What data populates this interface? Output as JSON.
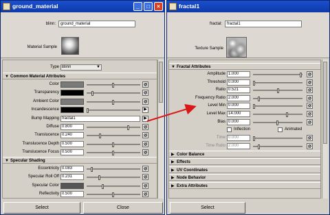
{
  "win1": {
    "title": "ground_material",
    "type_label": "blinn:",
    "name_value": "ground_material",
    "sample_label": "Material Sample",
    "type_row_label": "Type",
    "type_value": "Blinn",
    "sec_common": "Common Material Attributes",
    "color_label": "Color",
    "transparency_label": "Transparency",
    "ambient_label": "Ambient Color",
    "incandescence_label": "Incandescence",
    "bump_label": "Bump Mapping",
    "bump_value": "fractal1",
    "diffuse_label": "Diffuse",
    "diffuse_value": "0.800",
    "translucence_label": "Translucence",
    "translucence_value": "0.240",
    "tdepth_label": "Translucence Depth",
    "tdepth_value": "0.500",
    "tfocus_label": "Translucence Focus",
    "tfocus_value": "0.500",
    "sec_spec": "Specular Shading",
    "ecc_label": "Eccentricity",
    "ecc_value": "0.083",
    "sro_label": "Specular Roll Off",
    "sro_value": "0.231",
    "spec_color_label": "Specular Color",
    "refl_label": "Reflectivity",
    "refl_value": "0.500",
    "refl_color_label": "Reflected Color",
    "select": "Select",
    "close": "Close",
    "colors": {
      "color": "#7a7a7a",
      "transparency": "#000000",
      "ambient": "#7a7a7a",
      "incandescence": "#000000",
      "spec": "#555555",
      "refl_color": "#000000"
    },
    "levels": {
      "diffuse": 0.8,
      "translucence": 0.24,
      "tdepth": 0.5,
      "tfocus": 0.5,
      "ecc": 0.083,
      "sro": 0.231,
      "refl": 0.5,
      "color": 0.5,
      "transparency": 0.1,
      "ambient": 0.5,
      "incandescence": 0.0,
      "spec": 0.3
    }
  },
  "win2": {
    "title": "fractal1",
    "type_label": "fractal:",
    "name_value": "fractal1",
    "sample_label": "Texture Sample",
    "sec_fractal": "Fractal Attributes",
    "amp_label": "Amplitude",
    "amp_value": "1.000",
    "thr_label": "Threshold",
    "thr_value": "0.000",
    "ratio_label": "Ratio",
    "ratio_value": "0.521",
    "freq_label": "Frequency Ratio",
    "freq_value": "2.000",
    "lmin_label": "Level Min",
    "lmin_value": "0.000",
    "lmax_label": "Level Max",
    "lmax_value": "14.000",
    "bias_label": "Bias",
    "bias_value": "0.000",
    "inflection_label": "Inflection",
    "animated_label": "Animated",
    "time_label": "Time",
    "time_value": "0.000",
    "tratio_label": "Time Ratio",
    "tratio_value": "2.000",
    "sections": [
      "Color Balance",
      "Effects",
      "UV Coordinates",
      "Node Behavior",
      "Extra Attributes"
    ],
    "select": "Select",
    "levels": {
      "amp": 1.0,
      "thr": 0.0,
      "ratio": 0.521,
      "freq": 0.1,
      "lmin": 0.0,
      "lmax": 0.7,
      "bias": 0.5,
      "time": 0.0,
      "tratio": 0.1
    }
  }
}
